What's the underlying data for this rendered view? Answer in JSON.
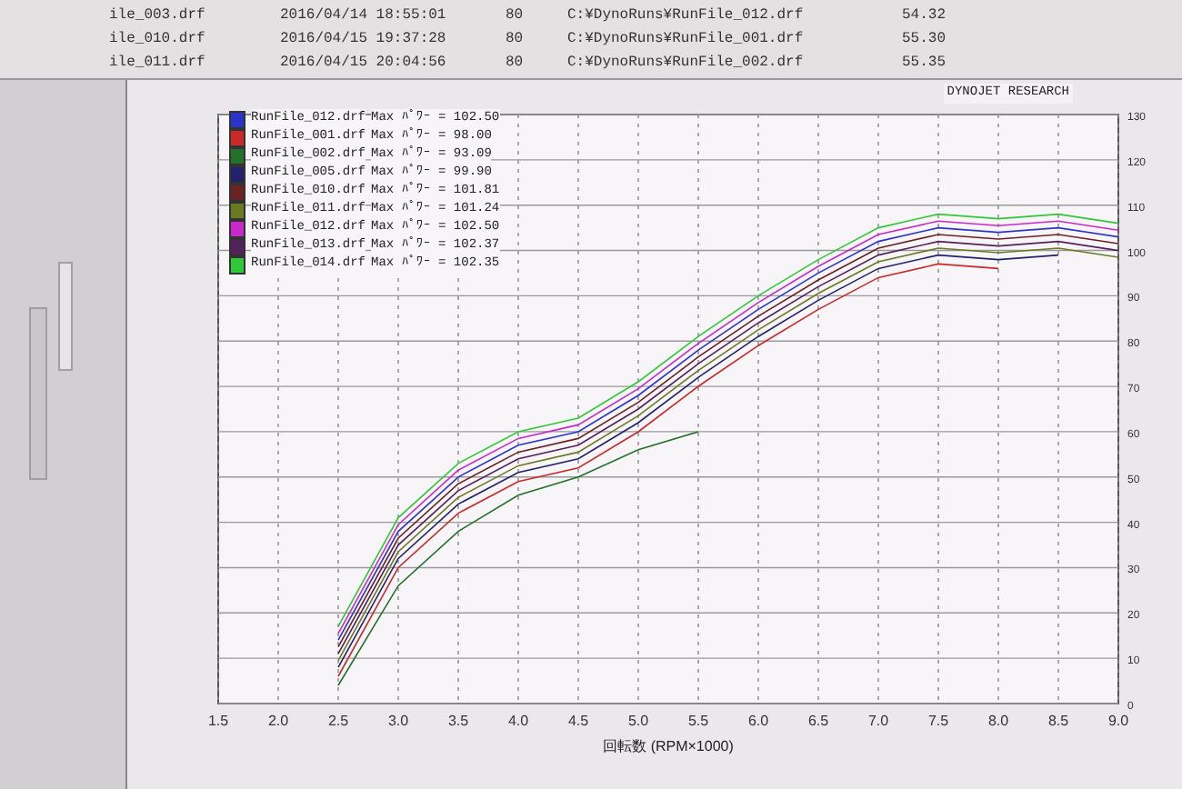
{
  "run_table": {
    "rows": [
      {
        "file": "ile_003.drf",
        "date": "2016/04/14 18:55:01",
        "number": "80",
        "path": "C:¥DynoRuns¥RunFile_012.drf",
        "value": "54.32"
      },
      {
        "file": "ile_010.drf",
        "date": "2016/04/15 19:37:28",
        "number": "80",
        "path": "C:¥DynoRuns¥RunFile_001.drf",
        "value": "55.30"
      },
      {
        "file": "ile_011.drf",
        "date": "2016/04/15 20:04:56",
        "number": "80",
        "path": "C:¥DynoRuns¥RunFile_002.drf",
        "value": "55.35"
      }
    ]
  },
  "chart": {
    "brand": "DYNOJET RESEARCH",
    "legend_values": [
      "Max ﾊﾟﾜｰ = 102.50",
      "Max ﾊﾟﾜｰ = 98.00",
      "Max ﾊﾟﾜｰ = 93.09",
      "Max ﾊﾟﾜｰ = 99.90",
      "Max ﾊﾟﾜｰ = 101.81",
      "Max ﾊﾟﾜｰ = 101.24",
      "Max ﾊﾟﾜｰ = 102.50",
      "Max ﾊﾟﾜｰ = 102.37",
      "Max ﾊﾟﾜｰ = 102.35"
    ],
    "chart_data": {
      "type": "line",
      "xlabel": "回転数 (RPM×1000)",
      "grid": true,
      "legend": true,
      "x": [
        2.5,
        3.0,
        3.5,
        4.0,
        4.5,
        5.0,
        5.5,
        6.0,
        6.5,
        7.0,
        7.5,
        8.0,
        8.5,
        9.0
      ],
      "xlim": [
        1.5,
        9.0
      ],
      "ylim": [
        0,
        130
      ],
      "xticks": [
        {
          "value": 1.5,
          "label": "1.5"
        },
        {
          "value": 2,
          "label": "2.0"
        },
        {
          "value": 2.5,
          "label": "2.5"
        },
        {
          "value": 3,
          "label": "3.0"
        },
        {
          "value": 3.5,
          "label": "3.5"
        },
        {
          "value": 4,
          "label": "4.0"
        },
        {
          "value": 4.5,
          "label": "4.5"
        },
        {
          "value": 5,
          "label": "5.0"
        },
        {
          "value": 5.5,
          "label": "5.5"
        },
        {
          "value": 6,
          "label": "6.0"
        },
        {
          "value": 6.5,
          "label": "6.5"
        },
        {
          "value": 7,
          "label": "7.0"
        },
        {
          "value": 7.5,
          "label": "7.5"
        },
        {
          "value": 8,
          "label": "8.0"
        },
        {
          "value": 8.5,
          "label": "8.5"
        },
        {
          "value": 9,
          "label": "9.0"
        }
      ],
      "yticks": [
        0,
        10,
        20,
        30,
        40,
        50,
        60,
        70,
        80,
        90,
        100,
        110,
        120,
        130
      ],
      "series": [
        {
          "name": "RunFile_012.drf",
          "color": "#2a35c8",
          "values": [
            14,
            38,
            50,
            57,
            60,
            68,
            78,
            87,
            95,
            102,
            105,
            104,
            105,
            103
          ]
        },
        {
          "name": "RunFile_001.drf",
          "color": "#c82a2a",
          "values": [
            6,
            30,
            42,
            49,
            52,
            60,
            70,
            79,
            87,
            94,
            97,
            96,
            null,
            null
          ]
        },
        {
          "name": "RunFile_002.drf",
          "color": "#24702a",
          "values": [
            4,
            26,
            38,
            46,
            50,
            56,
            60,
            null,
            null,
            null,
            null,
            null,
            null,
            null
          ]
        },
        {
          "name": "RunFile_005.drf",
          "color": "#22226a",
          "values": [
            8,
            32,
            44,
            51,
            54,
            62,
            72,
            81,
            89,
            96,
            99,
            98,
            99,
            null
          ]
        },
        {
          "name": "RunFile_010.drf",
          "color": "#6a2222",
          "values": [
            12.5,
            36.5,
            48.5,
            55.5,
            58.5,
            66.5,
            76.5,
            85.5,
            93.5,
            100.5,
            103.5,
            102.5,
            103.5,
            101.5
          ]
        },
        {
          "name": "RunFile_011.drf",
          "color": "#6a7a22",
          "values": [
            9.5,
            33.5,
            45.5,
            52.5,
            55.5,
            63.5,
            73.5,
            82.5,
            90.5,
            97.5,
            100.5,
            99.5,
            100.5,
            98.5
          ]
        },
        {
          "name": "RunFile_012.drf",
          "color": "#c82ac8",
          "values": [
            15.5,
            39.5,
            51.5,
            58.5,
            61.5,
            69.5,
            79.5,
            88.5,
            96.5,
            103.5,
            106.5,
            105.5,
            106.5,
            104.5
          ]
        },
        {
          "name": "RunFile_013.drf",
          "color": "#52225a",
          "values": [
            11,
            35,
            47,
            54,
            57,
            65,
            75,
            84,
            92,
            99,
            102,
            101,
            102,
            100
          ]
        },
        {
          "name": "RunFile_014.drf",
          "color": "#30c838",
          "values": [
            17,
            41,
            53,
            60,
            63,
            71,
            81,
            90,
            98,
            105,
            108,
            107,
            108,
            106
          ]
        }
      ]
    }
  }
}
